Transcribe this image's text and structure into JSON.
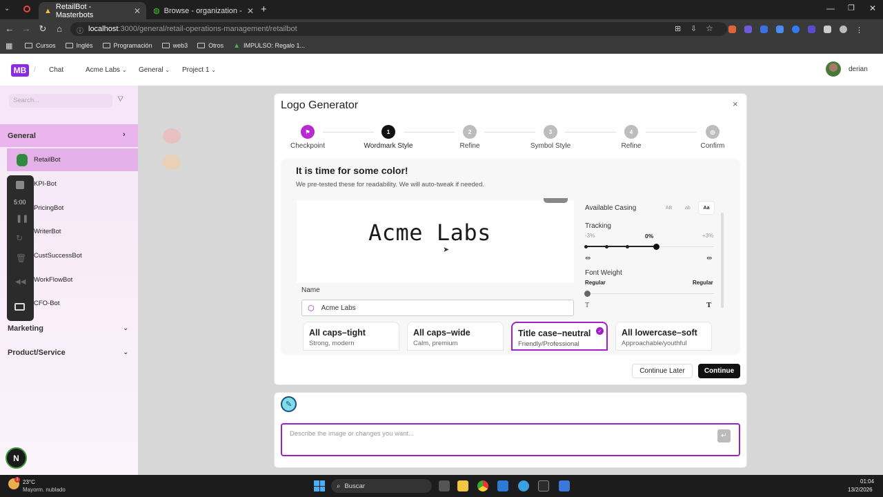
{
  "browser": {
    "tabs": [
      {
        "title": "RetailBot - Masterbots"
      },
      {
        "title": "Browse - organization - Data | I"
      }
    ],
    "url_host": "localhost",
    "url_path": ":3000/general/retail-operations-management/retailbot",
    "bookmarks": [
      "Cursos",
      "Inglés",
      "Programación",
      "web3",
      "Otros",
      "IMPULSO: Regalo 1..."
    ]
  },
  "header": {
    "logo": "MB",
    "sep": "/",
    "nav": [
      "Chat",
      "Acme Labs",
      "General",
      "Project 1"
    ],
    "username": "derian"
  },
  "sidebar": {
    "search_placeholder": "Search...",
    "general_label": "General",
    "bots": [
      "RetailBot",
      "KPI-Bot",
      "PricingBot",
      "WriterBot",
      "CustSuccessBot",
      "WorkFlowBot",
      "CFO-Bot"
    ],
    "timer": "5:00",
    "sections": [
      "Marketing",
      "Product/Service"
    ]
  },
  "modal": {
    "title": "Logo Generator",
    "close": "×",
    "steps": [
      {
        "num": "⚑",
        "label": "Checkpoint",
        "state": "done"
      },
      {
        "num": "1",
        "label": "Wordmark Style",
        "state": "current"
      },
      {
        "num": "2",
        "label": "Refine",
        "state": "pending"
      },
      {
        "num": "3",
        "label": "Symbol Style",
        "state": "pending"
      },
      {
        "num": "4",
        "label": "Refine",
        "state": "pending"
      },
      {
        "num": "◎",
        "label": "Confirm",
        "state": "pending"
      }
    ],
    "heading": "It is time for some color!",
    "subheading": "We pre-tested these for readability. We will auto-tweak if needed.",
    "preview_text": "Acme Labs",
    "name_label": "Name",
    "name_value": "Acme Labs",
    "casing_label": "Available Casing",
    "casing_options": [
      "AB",
      "ab",
      "Aa"
    ],
    "tracking_label": "Tracking",
    "tracking_min": "-3%",
    "tracking_value": "0%",
    "tracking_max": "+3%",
    "tracking_level": 0.55,
    "weight_label": "Font Weight",
    "weight_min": "Regular",
    "weight_max": "Regular",
    "weight_level": 0,
    "cards": [
      {
        "title": "All caps–tight",
        "sub": "Strong, modern",
        "selected": false
      },
      {
        "title": "All caps–wide",
        "sub": "Calm, premium",
        "selected": false
      },
      {
        "title": "Title case–neutral",
        "sub": "Friendly/Professional",
        "selected": true
      },
      {
        "title": "All lowercase–soft",
        "sub": "Approachable/youthful",
        "selected": false
      }
    ],
    "continue_later": "Continue Later",
    "continue": "Continue"
  },
  "chat": {
    "placeholder": "Describe the image or changes you want..."
  },
  "taskbar": {
    "weather_temp": "23°C",
    "weather_desc": "Mayorm. nublado",
    "weather_badge": "1",
    "search": "Buscar",
    "time": "01:04",
    "date": "13/2/2026"
  },
  "colors": {
    "accent": "#a020c8",
    "primary_button": "#111111",
    "sidebar_active": "#e3b1e7"
  }
}
